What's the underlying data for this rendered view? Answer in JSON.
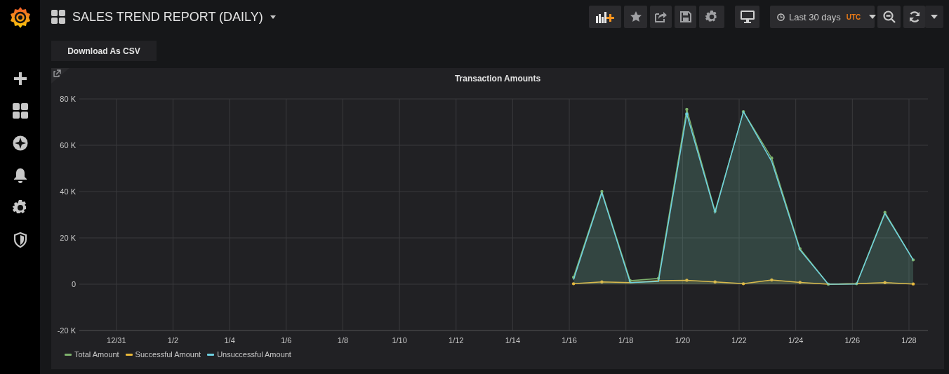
{
  "dashboard": {
    "title": "SALES TREND REPORT (DAILY)"
  },
  "time_picker": {
    "range": "Last 30 days",
    "timezone": "UTC"
  },
  "buttons": [
    {
      "label": "Download As CSV"
    }
  ],
  "panel": {
    "title": "Transaction Amounts",
    "chart_data": {
      "type": "area",
      "categories": [
        null,
        "12/31",
        null,
        "1/2",
        null,
        "1/4",
        null,
        "1/6",
        null,
        "1/8",
        null,
        "1/10",
        null,
        "1/12",
        null,
        "1/14",
        null,
        "1/16",
        null,
        "1/18",
        null,
        "1/20",
        null,
        "1/22",
        null,
        "1/24",
        null,
        "1/26",
        null,
        "1/28"
      ],
      "series": [
        {
          "name": "Total Amount",
          "color": "#7eb26d",
          "values": [
            null,
            null,
            null,
            null,
            null,
            null,
            null,
            null,
            null,
            null,
            null,
            null,
            null,
            null,
            null,
            null,
            null,
            3000,
            40000,
            1500,
            2500,
            75500,
            31500,
            74500,
            54500,
            15300,
            0,
            200,
            31000,
            10500
          ]
        },
        {
          "name": "Successful Amount",
          "color": "#eab839",
          "values": [
            null,
            null,
            null,
            null,
            null,
            null,
            null,
            null,
            null,
            null,
            null,
            null,
            null,
            null,
            null,
            null,
            null,
            200,
            1000,
            700,
            1500,
            1700,
            1000,
            200,
            1800,
            800,
            0,
            200,
            700,
            100
          ]
        },
        {
          "name": "Unsuccessful Amount",
          "color": "#6ed0e0",
          "values": [
            null,
            null,
            null,
            null,
            null,
            null,
            null,
            null,
            null,
            null,
            null,
            null,
            null,
            null,
            null,
            null,
            null,
            2000,
            39500,
            700,
            1200,
            73500,
            31000,
            74500,
            53000,
            14800,
            0,
            100,
            30500,
            10500
          ]
        }
      ],
      "ylim": [
        -20000,
        80000
      ],
      "grid": true,
      "yticks": [
        {
          "value": -20000,
          "label": "-20 K"
        },
        {
          "value": 0,
          "label": "0"
        },
        {
          "value": 20000,
          "label": "20 K"
        },
        {
          "value": 40000,
          "label": "40 K"
        },
        {
          "value": 60000,
          "label": "60 K"
        },
        {
          "value": 80000,
          "label": "80 K"
        }
      ]
    }
  }
}
